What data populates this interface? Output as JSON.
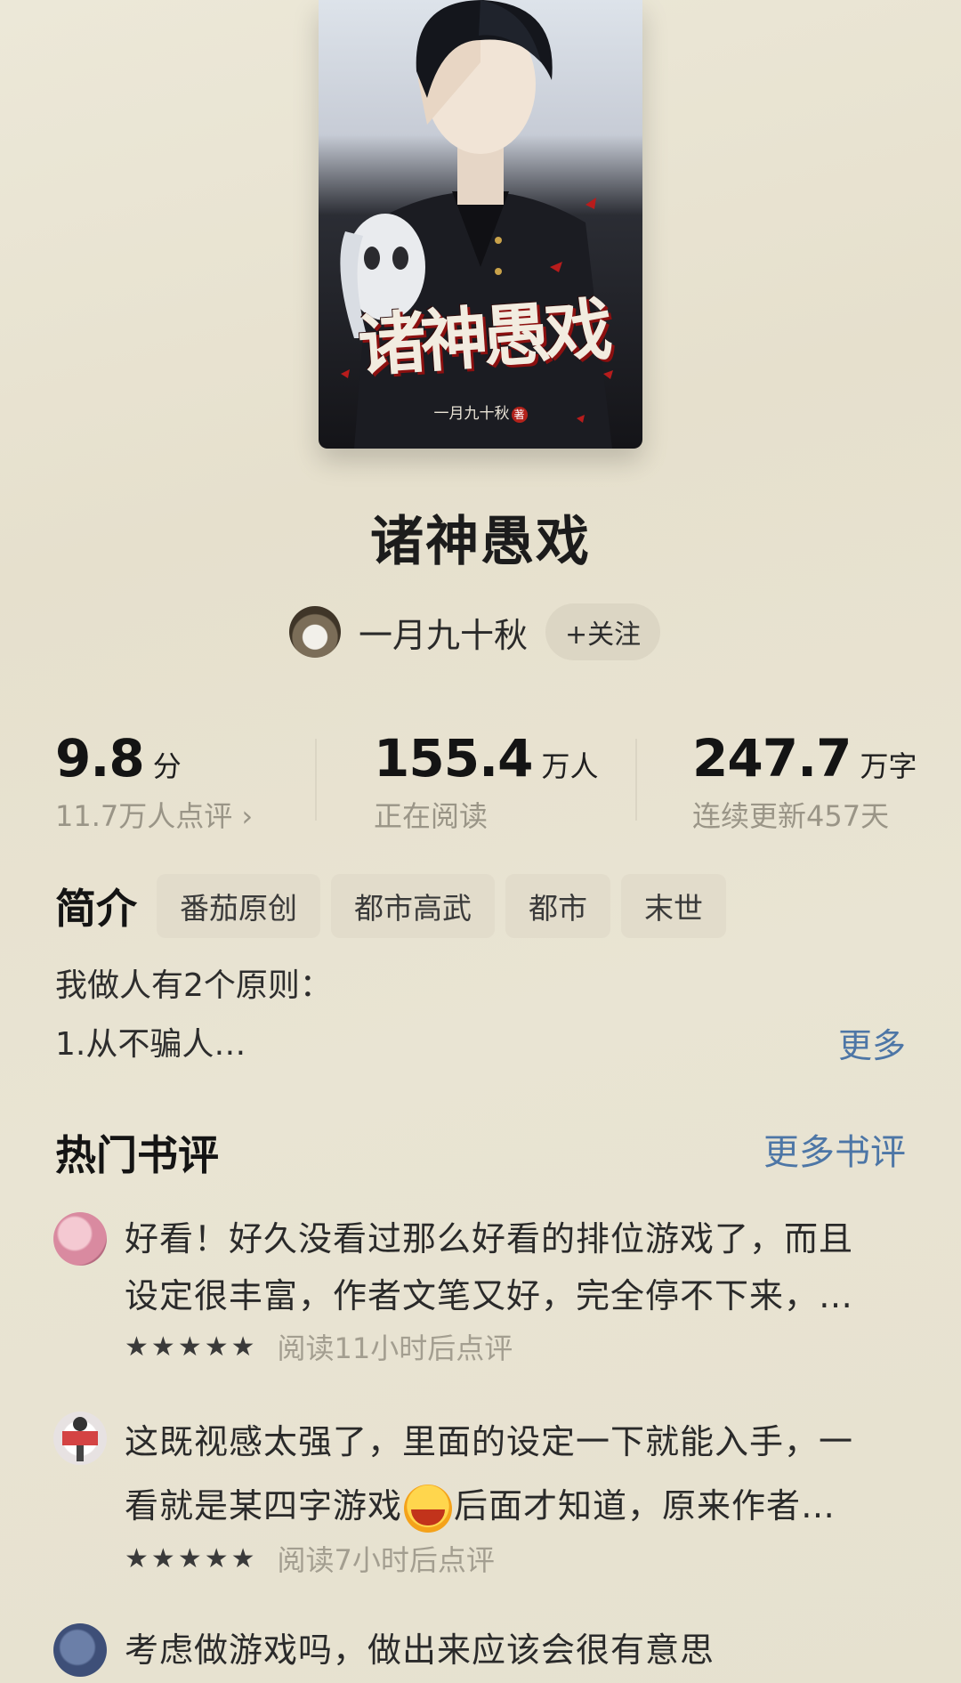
{
  "book": {
    "cover_title": "诸神愚戏",
    "cover_author": "一月九十秋",
    "cover_author_mark": "著",
    "title": "诸神愚戏"
  },
  "author": {
    "name": "一月九十秋",
    "follow_label": "+关注"
  },
  "stats": {
    "rating": {
      "value": "9.8",
      "unit": "分",
      "sub": "11.7万人点评 ›"
    },
    "readers": {
      "value": "155.4",
      "unit": "万人",
      "sub": "正在阅读"
    },
    "words": {
      "value": "247.7",
      "unit": "万字",
      "sub": "连续更新457天"
    }
  },
  "intro": {
    "label": "简介",
    "tags": [
      "番茄原创",
      "都市高武",
      "都市",
      "末世"
    ],
    "lines": [
      "我做人有2个原则：",
      "1.从不骗人…"
    ],
    "more_label": "更多"
  },
  "reviews": {
    "title": "热门书评",
    "more_label": "更多书评",
    "items": [
      {
        "lines": [
          "好看！好久没看过那么好看的排位游戏了，而且",
          "设定很丰富，作者文笔又好，完全停不下来，…"
        ],
        "stars": 5,
        "time": "阅读11小时后点评"
      },
      {
        "line1": "这既视感太强了，里面的设定一下就能入手，一",
        "line2_before": "看就是某四字游戏",
        "line2_after": "后面才知道，原来作者…",
        "emoji": "laughing-crying-emoji",
        "stars": 5,
        "time": "阅读7小时后点评"
      },
      {
        "lines": [
          "考虑做游戏吗，做出来应该会很有意思"
        ]
      }
    ]
  },
  "colors": {
    "background": "#e9e4d3",
    "link": "#4d76a6",
    "muted": "#9a9587",
    "tag_bg": "#e2dccb"
  }
}
